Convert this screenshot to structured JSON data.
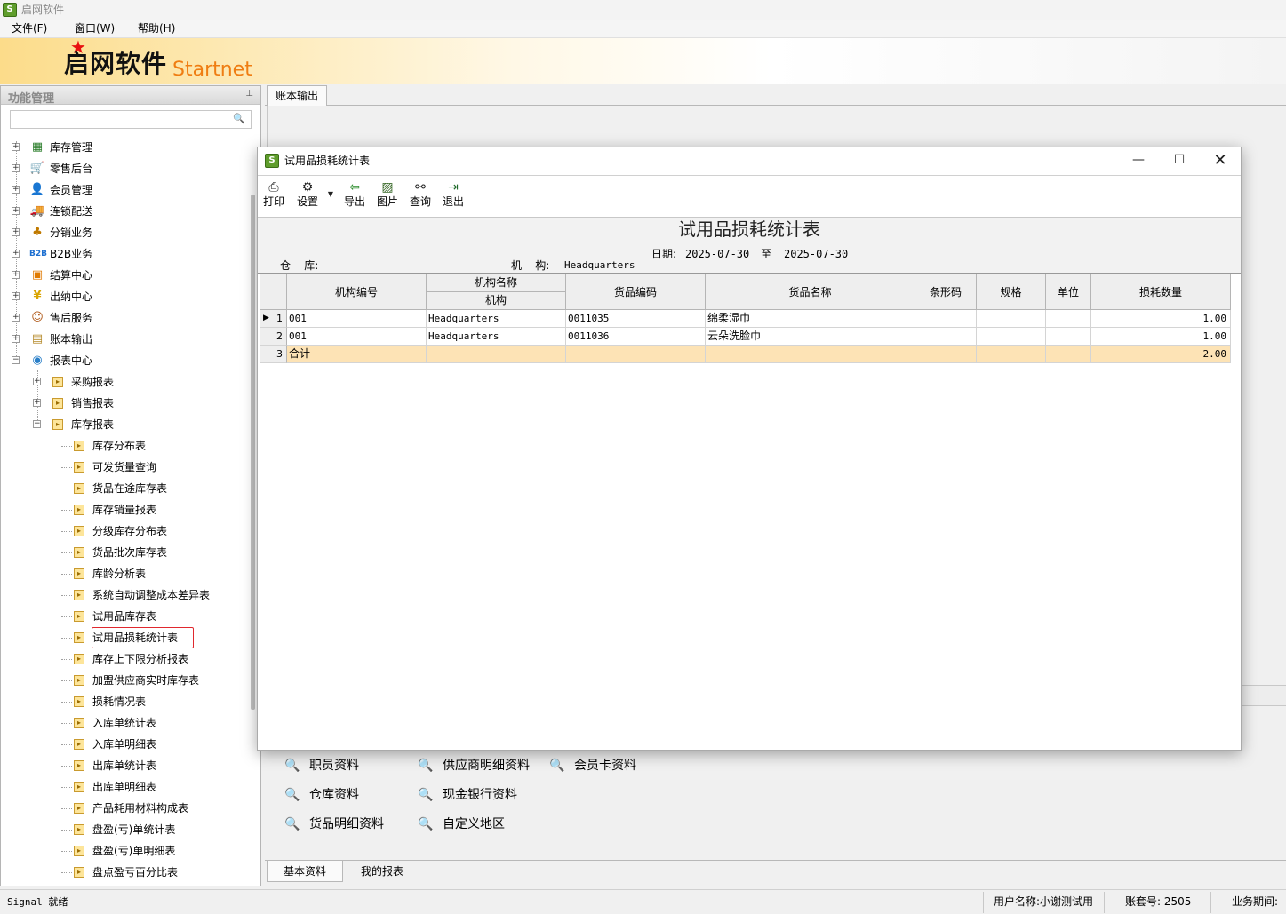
{
  "window": {
    "title": "启网软件"
  },
  "menu": [
    {
      "label": "文件(F)"
    },
    {
      "label": "窗口(W)"
    },
    {
      "label": "帮助(H)"
    }
  ],
  "banner": {
    "brand_cn": "启网软件",
    "brand_en": "Startnet"
  },
  "left_panel": {
    "title": "功能管理",
    "pin": "ᵖ",
    "search": {
      "value": "",
      "placeholder": ""
    },
    "top_items": [
      {
        "label": "库存管理",
        "icon": "boxes-icon"
      },
      {
        "label": "零售后台",
        "icon": "cart-icon"
      },
      {
        "label": "会员管理",
        "icon": "member-icon"
      },
      {
        "label": "连锁配送",
        "icon": "truck-icon"
      },
      {
        "label": "分销业务",
        "icon": "network-icon"
      },
      {
        "label": "B2B业务",
        "icon": "b2b-icon"
      },
      {
        "label": "结算中心",
        "icon": "settlement-icon"
      },
      {
        "label": "出纳中心",
        "icon": "yen-icon"
      },
      {
        "label": "售后服务",
        "icon": "service-icon"
      },
      {
        "label": "账本输出",
        "icon": "ledger-icon"
      },
      {
        "label": "报表中心",
        "icon": "report-icon"
      }
    ],
    "report_children": [
      {
        "label": "采购报表"
      },
      {
        "label": "销售报表"
      },
      {
        "label": "库存报表"
      }
    ],
    "inventory_reports": [
      {
        "label": "库存分布表"
      },
      {
        "label": "可发货量查询"
      },
      {
        "label": "货品在途库存表"
      },
      {
        "label": "库存销量报表"
      },
      {
        "label": "分级库存分布表"
      },
      {
        "label": "货品批次库存表"
      },
      {
        "label": "库龄分析表"
      },
      {
        "label": "系统自动调整成本差异表"
      },
      {
        "label": "试用品库存表"
      },
      {
        "label": "试用品损耗统计表"
      },
      {
        "label": "库存上下限分析报表"
      },
      {
        "label": "加盟供应商实时库存表"
      },
      {
        "label": "损耗情况表"
      },
      {
        "label": "入库单统计表"
      },
      {
        "label": "入库单明细表"
      },
      {
        "label": "出库单统计表"
      },
      {
        "label": "出库单明细表"
      },
      {
        "label": "产品耗用材料构成表"
      },
      {
        "label": "盘盈(亏)单统计表"
      },
      {
        "label": "盘盈(亏)单明细表"
      },
      {
        "label": "盘点盈亏百分比表"
      }
    ]
  },
  "main": {
    "top_tab": "账本输出",
    "quick_links": [
      {
        "label": "职员资料"
      },
      {
        "label": "供应商明细资料"
      },
      {
        "label": "会员卡资料"
      },
      {
        "label": "仓库资料"
      },
      {
        "label": "现金银行资料"
      },
      {
        "label": "货品明细资料"
      },
      {
        "label": "自定义地区"
      }
    ],
    "bottom_tabs": [
      {
        "label": "基本资料"
      },
      {
        "label": "我的报表"
      }
    ]
  },
  "dialog": {
    "title": "试用品损耗统计表",
    "toolbar": [
      {
        "label": "打印",
        "icon": "printer-icon"
      },
      {
        "label": "设置",
        "icon": "settings-icon"
      },
      {
        "label": "导出",
        "icon": "export-icon"
      },
      {
        "label": "图片",
        "icon": "picture-icon"
      },
      {
        "label": "查询",
        "icon": "binoculars-icon"
      },
      {
        "label": "退出",
        "icon": "exit-icon"
      }
    ],
    "report": {
      "title": "试用品损耗统计表",
      "date_label": "日期:",
      "date_from": "2025-07-30",
      "date_sep": "至",
      "date_to": "2025-07-30",
      "warehouse_label": "仓    库:",
      "warehouse_value": "",
      "org_label": "机    构:",
      "org_value": "Headquarters"
    },
    "grid": {
      "headers": {
        "org_code": "机构编号",
        "org_name_group": "机构名称",
        "org_name": "机构",
        "item_code": "货品编码",
        "item_name": "货品名称",
        "barcode": "条形码",
        "spec": "规格",
        "unit": "单位",
        "loss_qty": "损耗数量"
      },
      "rows": [
        {
          "no": "1",
          "org_code": "001",
          "org_name": "Headquarters",
          "item_code": "0011035",
          "item_name": "绵柔湿巾",
          "barcode": "",
          "spec": "",
          "unit": "",
          "loss_qty": "1.00"
        },
        {
          "no": "2",
          "org_code": "001",
          "org_name": "Headquarters",
          "item_code": "0011036",
          "item_name": "云朵洗脸巾",
          "barcode": "",
          "spec": "",
          "unit": "",
          "loss_qty": "1.00"
        }
      ],
      "total": {
        "no": "3",
        "label": "合计",
        "loss_qty": "2.00"
      }
    }
  },
  "status": {
    "left": "Signal 就绪",
    "user": "用户名称:小谢测试用",
    "account": "账套号: 2505",
    "period": "业务期间:"
  }
}
